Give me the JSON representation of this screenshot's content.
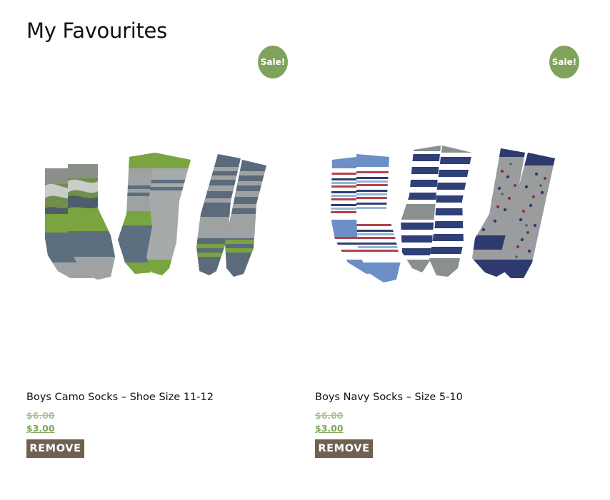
{
  "page": {
    "title": "My Favourites"
  },
  "colors": {
    "sale_badge": "#7fa35a",
    "price": "#7fa35a",
    "old_price": "#a9c394",
    "remove_button": "#6e6150"
  },
  "products": [
    {
      "badge": "Sale!",
      "name": "Boys Camo Socks – Shoe Size 11-12",
      "old_price": "$6.00",
      "price": "$3.00",
      "remove_label": "REMOVE"
    },
    {
      "badge": "Sale!",
      "name": "Boys Navy Socks – Size 5-10",
      "old_price": "$6.00",
      "price": "$3.00",
      "remove_label": "REMOVE"
    }
  ]
}
